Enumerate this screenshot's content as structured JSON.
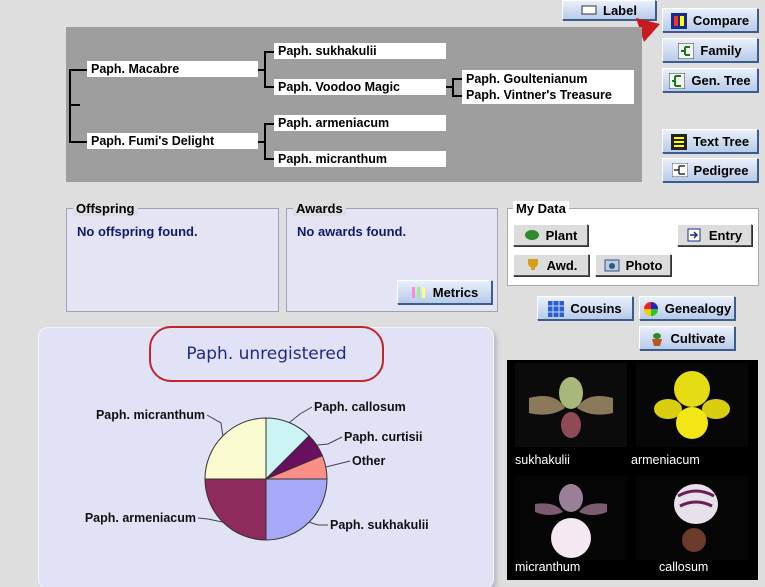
{
  "toolbar": {
    "label": "Label",
    "compare": "Compare",
    "family": "Family",
    "gen_tree": "Gen. Tree",
    "text_tree": "Text Tree",
    "pedigree": "Pedigree"
  },
  "tree": {
    "parent1": "Paph. Macabre",
    "parent2": "Paph. Fumi's Delight",
    "gp1": "Paph. sukhakulii",
    "gp2": "Paph. Voodoo Magic",
    "gp3": "Paph. armeniacum",
    "gp4": "Paph. micranthum",
    "ggp1": "Paph. Goultenianum",
    "ggp2": "Paph. Vintner's Treasure"
  },
  "offspring": {
    "caption": "Offspring",
    "message": "No offspring found."
  },
  "awards": {
    "caption": "Awards",
    "message": "No awards found.",
    "metrics": "Metrics"
  },
  "mydata": {
    "caption": "My Data",
    "plant": "Plant",
    "entry": "Entry",
    "awd": "Awd.",
    "photo": "Photo"
  },
  "actions": {
    "cousins": "Cousins",
    "genealogy": "Genealogy",
    "cultivate": "Cultivate"
  },
  "chart_data": {
    "type": "pie",
    "title": "Paph. unregistered",
    "slices": [
      {
        "label": "Paph. callosum",
        "value": 12.5,
        "color": "#ccf4f4"
      },
      {
        "label": "Paph. curtisii",
        "value": 6.25,
        "color": "#6a0f5e"
      },
      {
        "label": "Other",
        "value": 6.25,
        "color": "#fb8f88"
      },
      {
        "label": "Paph. sukhakulii",
        "value": 25,
        "color": "#a8a8f8"
      },
      {
        "label": "Paph. armeniacum",
        "value": 25,
        "color": "#8f2a5c"
      },
      {
        "label": "Paph. micranthum",
        "value": 25,
        "color": "#fbfbd1"
      }
    ]
  },
  "photos": [
    {
      "caption": "sukhakulii"
    },
    {
      "caption": "armeniacum"
    },
    {
      "caption": "micranthum"
    },
    {
      "caption": "callosum"
    }
  ]
}
